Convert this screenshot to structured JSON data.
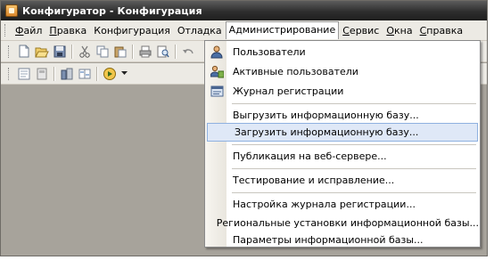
{
  "window": {
    "title": "Конфигуратор - Конфигурация"
  },
  "menubar": {
    "items": [
      {
        "label": "Файл",
        "u": "Ф",
        "rest": "айл"
      },
      {
        "label": "Правка",
        "u": "П",
        "rest": "равка"
      },
      {
        "label": "Конфигурация",
        "u": "",
        "rest": "Конфигурация"
      },
      {
        "label": "Отладка",
        "u": "",
        "rest": "Отладка"
      },
      {
        "label": "Администрирование",
        "u": "",
        "rest": "Администрирование"
      },
      {
        "label": "Сервис",
        "u": "С",
        "rest": "ервис"
      },
      {
        "label": "Окна",
        "u": "О",
        "rest": "кна"
      },
      {
        "label": "Справка",
        "u": "С",
        "rest": "правка"
      }
    ],
    "active_index": 4
  },
  "toolbar1": {
    "icons": [
      "new-document-icon",
      "open-folder-icon",
      "save-icon",
      "cut-icon",
      "copy-icon",
      "paste-icon",
      "print-icon",
      "print-preview-icon",
      "undo-icon"
    ]
  },
  "toolbar2": {
    "icons": [
      "config-tree-icon",
      "db-config-icon",
      "update-config-icon",
      "compare-icon",
      "run-debug-icon"
    ]
  },
  "admin_menu": {
    "items": [
      {
        "label": "Пользователи",
        "icon": "users-icon"
      },
      {
        "label": "Активные пользователи",
        "icon": "active-users-icon"
      },
      {
        "label": "Журнал регистрации",
        "icon": "event-log-icon"
      },
      {
        "label": "Выгрузить информационную базу..."
      },
      {
        "label": "Загрузить информационную базу...",
        "highlighted": true
      },
      {
        "label": "Публикация на веб-сервере..."
      },
      {
        "label": "Тестирование и исправление..."
      },
      {
        "label": "Настройка журнала регистрации..."
      },
      {
        "label": "Региональные установки информационной базы..."
      },
      {
        "label": "Параметры информационной базы..."
      }
    ]
  },
  "colors": {
    "title_bar": "#2e2e2e",
    "desktop": "#a7a39b",
    "menu_highlight": "#dfe8f7",
    "menu_highlight_border": "#8fb1e0"
  }
}
